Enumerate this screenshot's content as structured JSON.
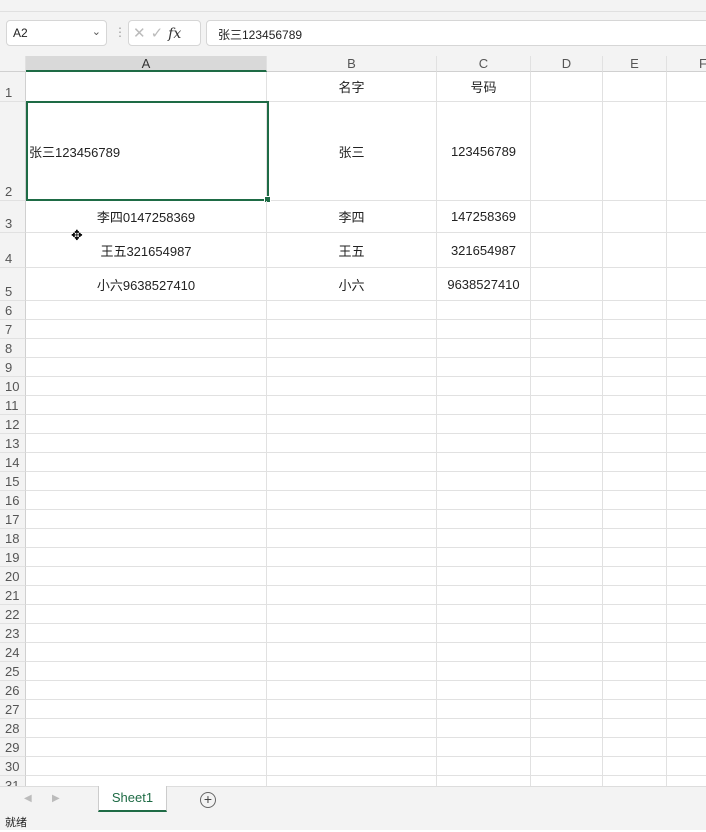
{
  "name_box": "A2",
  "formula": "张三123456789",
  "columns": [
    "A",
    "B",
    "C",
    "D",
    "E",
    "F"
  ],
  "selected_column": "A",
  "rows": [
    [
      "",
      "名字",
      "号码"
    ],
    [
      "张三123456789",
      "张三",
      "123456789"
    ],
    [
      "李四0147258369",
      "李四",
      "147258369"
    ],
    [
      "王五321654987",
      "王五",
      "321654987"
    ],
    [
      "小六9638527410",
      "小六",
      "9638527410"
    ]
  ],
  "row_count": 31,
  "sheet_tab": "Sheet1",
  "status": "就绪"
}
